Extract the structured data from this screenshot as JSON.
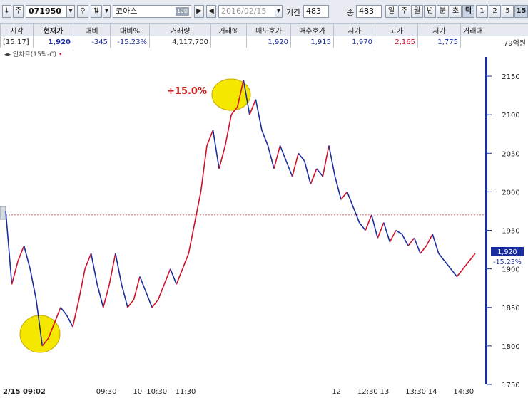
{
  "toolbar": {
    "code": "071950",
    "stock_name": "코아스",
    "name_badge": "100",
    "date": "2016/02/15",
    "period_label": "기간",
    "period_value": "483",
    "count_label": "종",
    "count_value": "483",
    "tabs": [
      "일",
      "주",
      "월",
      "년",
      "분",
      "초",
      "틱",
      "1",
      "2",
      "5",
      "15"
    ],
    "active_tab": "틱",
    "left_label": "주"
  },
  "quote": {
    "headers": [
      "시각",
      "현재가",
      "대비",
      "대비%",
      "거래량",
      "거래%",
      "매도호가",
      "매수호가",
      "시가",
      "고가",
      "저가",
      "거래대"
    ],
    "values": [
      "[15:17]",
      "1,920",
      "-345",
      "-15.23%",
      "4,117,700",
      "",
      "1,920",
      "1,915",
      "1,970",
      "2,165",
      "1,775",
      "79억원"
    ]
  },
  "chart_title": "인차트(15틱-C)",
  "chart_data": {
    "type": "line",
    "series": [
      {
        "values": [
          1975,
          1880,
          1910,
          1930,
          1900,
          1860,
          1800,
          1810,
          1830,
          1850,
          1840,
          1825,
          1860,
          1900,
          1920,
          1880,
          1850,
          1880,
          1920,
          1880,
          1850,
          1860,
          1890,
          1870,
          1850,
          1860,
          1880,
          1900,
          1880,
          1900,
          1920,
          1960,
          2000,
          2060,
          2080,
          2030,
          2060,
          2100,
          2110,
          2145,
          2100,
          2120,
          2080,
          2060,
          2030,
          2060,
          2040,
          2020,
          2050,
          2040,
          2010,
          2030,
          2020,
          2060,
          2020,
          1990,
          2000,
          1980,
          1960,
          1950,
          1970,
          1940,
          1960,
          1935,
          1950,
          1945,
          1930,
          1940,
          1920,
          1930,
          1945,
          1920,
          1910,
          1900,
          1890,
          1900,
          1910,
          1920
        ]
      }
    ],
    "x_tick_labels": [
      "2/15 09:02",
      "09:30",
      "10",
      "10:30",
      "11:30",
      "12",
      "12:30",
      "13",
      "13:30",
      "14",
      "14:30"
    ],
    "y_tick_labels": [
      "2150",
      "2100",
      "2050",
      "2000",
      "1950",
      "1900",
      "1850",
      "1800",
      "1750"
    ],
    "ylim": [
      1750,
      2175
    ],
    "reference_value": 1970,
    "current_price_label": "1,920",
    "current_change_label": "-15.23%",
    "annotation": "+15.0%",
    "colors": {
      "up": "#d0102a",
      "down": "#1a2da0",
      "reference": "#e06060",
      "annotation": "#d02020",
      "highlight": "#f5e800"
    }
  }
}
